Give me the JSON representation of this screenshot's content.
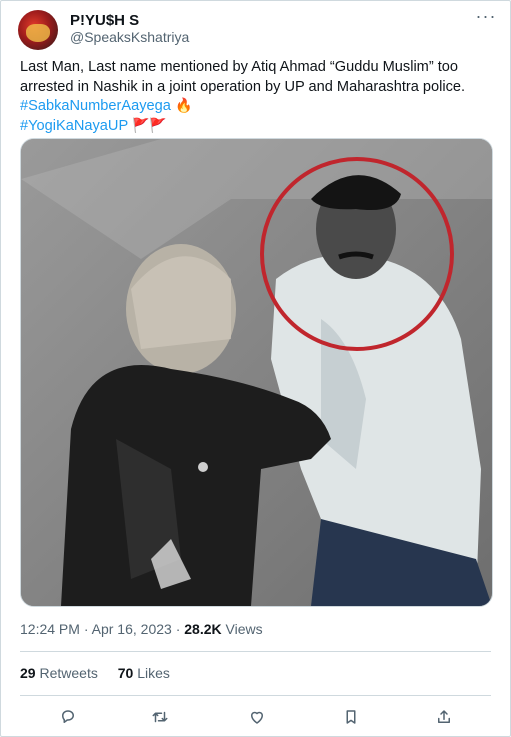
{
  "author": {
    "name": "P!YU$H S",
    "handle": "@SpeaksKshatriya"
  },
  "tweet": {
    "line1": "Last Man, Last name mentioned by Atiq Ahmad “Guddu Muslim” too arrested in Nashik in a joint operation by UP and Maharashtra police.",
    "hashtag1": "#SabkaNumberAayega",
    "hashtag2": "#YogiKaNayaUP",
    "emoji_fire": "🔥",
    "emoji_flags": "🚩🚩"
  },
  "meta": {
    "time": "12:24 PM",
    "separator": "·",
    "date": "Apr 16, 2023",
    "views_count": "28.2K",
    "views_label": "Views"
  },
  "stats": {
    "retweets_count": "29",
    "retweets_label": "Retweets",
    "likes_count": "70",
    "likes_label": "Likes"
  },
  "more_glyph": "···",
  "colors": {
    "link": "#1d9bf0",
    "secondary": "#536471",
    "border": "#cfd9de",
    "circle": "#c0262d"
  },
  "icons": [
    "reply-icon",
    "retweet-icon",
    "like-icon",
    "bookmark-icon",
    "share-icon"
  ]
}
